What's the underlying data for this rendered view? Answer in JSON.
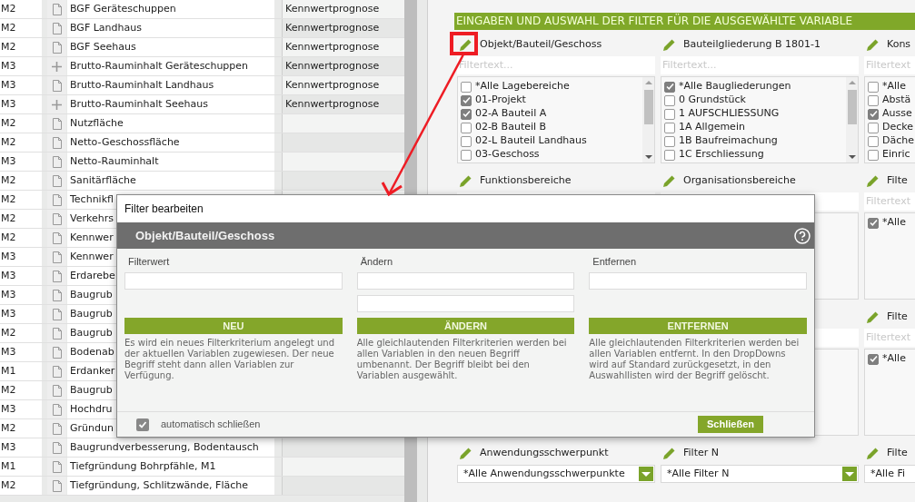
{
  "variables_table": {
    "rows": [
      {
        "unit": "M2",
        "kind": "leaf",
        "name": "BGF Geräteschuppen",
        "type": "Kennwertprognose"
      },
      {
        "unit": "M2",
        "kind": "leaf",
        "name": "BGF Landhaus",
        "type": "Kennwertprognose"
      },
      {
        "unit": "M2",
        "kind": "leaf",
        "name": "BGF Seehaus",
        "type": "Kennwertprognose"
      },
      {
        "unit": "M3",
        "kind": "group",
        "name": "Brutto-Rauminhalt Geräteschuppen",
        "type": "Kennwertprognose"
      },
      {
        "unit": "M3",
        "kind": "leaf",
        "name": "Brutto-Rauminhalt Landhaus",
        "type": "Kennwertprognose"
      },
      {
        "unit": "M3",
        "kind": "group",
        "name": "Brutto-Rauminhalt Seehaus",
        "type": "Kennwertprognose"
      },
      {
        "unit": "M2",
        "kind": "leaf",
        "name": "Nutzfläche"
      },
      {
        "unit": "M2",
        "kind": "leaf",
        "name": "Netto-Geschossfläche"
      },
      {
        "unit": "M3",
        "kind": "leaf",
        "name": "Netto-Rauminhalt"
      },
      {
        "unit": "M2",
        "kind": "leaf",
        "name": "Sanitärfläche"
      },
      {
        "unit": "M2",
        "kind": "leaf",
        "name": "Technikfl"
      },
      {
        "unit": "M2",
        "kind": "leaf",
        "name": "Verkehrs"
      },
      {
        "unit": "M2",
        "kind": "leaf",
        "name": "Kennwer"
      },
      {
        "unit": "M3",
        "kind": "leaf",
        "name": "Kennwer"
      },
      {
        "unit": "M3",
        "kind": "leaf",
        "name": "Erdarebe"
      },
      {
        "unit": "M3",
        "kind": "leaf",
        "name": "Baugrub"
      },
      {
        "unit": "M3",
        "kind": "leaf",
        "name": "Baugrub"
      },
      {
        "unit": "M2",
        "kind": "leaf",
        "name": "Baugrub"
      },
      {
        "unit": "M3",
        "kind": "leaf",
        "name": "Bodenab"
      },
      {
        "unit": "M1",
        "kind": "leaf",
        "name": "Erdanker"
      },
      {
        "unit": "M2",
        "kind": "leaf",
        "name": "Baugrub"
      },
      {
        "unit": "M3",
        "kind": "leaf",
        "name": "Hochdru"
      },
      {
        "unit": "M2",
        "kind": "leaf",
        "name": "Gründun"
      },
      {
        "unit": "M3",
        "kind": "leaf",
        "name": "Baugrundverbesserung, Bodentausch"
      },
      {
        "unit": "M1",
        "kind": "leaf",
        "name": "Tiefgründung Bohrpfähle, M1"
      },
      {
        "unit": "M2",
        "kind": "leaf",
        "name": "Tiefgründung, Schlitzwände, Fläche"
      }
    ]
  },
  "filter_panel": {
    "title": "EINGABEN UND AUSWAHL DER FILTER FÜR DIE AUSGEWÄHLTE VARIABLE",
    "columns": [
      {
        "groups": [
          {
            "kind": "list",
            "title": "Objekt/Bauteil/Geschoss",
            "placeholder": "Filtertext...",
            "items": [
              {
                "label": "*Alle Lagebereiche",
                "checked": false
              },
              {
                "label": "01-Projekt",
                "checked": true
              },
              {
                "label": "02-A Bauteil A",
                "checked": true
              },
              {
                "label": "02-B Bauteil B",
                "checked": false
              },
              {
                "label": "02-L Bauteil Landhaus",
                "checked": false
              },
              {
                "label": "03-Geschoss",
                "checked": false
              }
            ]
          },
          {
            "kind": "blank",
            "title": "Funktionsbereiche"
          },
          {
            "kind": "blank"
          },
          {
            "kind": "dropdown",
            "title": "Anwendungsschwerpunkt",
            "value": "*Alle Anwendungsschwerpunkte"
          }
        ]
      },
      {
        "groups": [
          {
            "kind": "list",
            "title": "Bauteilgliederung B 1801-1",
            "placeholder": "Filtertext...",
            "items": [
              {
                "label": "*Alle Baugliederungen",
                "checked": true
              },
              {
                "label": "0 Grundstück",
                "checked": false
              },
              {
                "label": "1 AUFSCHLIESSUNG",
                "checked": false
              },
              {
                "label": "1A Allgemein",
                "checked": false
              },
              {
                "label": "1B Baufreimachung",
                "checked": false
              },
              {
                "label": "1C Erschliessung",
                "checked": false
              }
            ]
          },
          {
            "kind": "blank",
            "title": "Organisationsbereiche"
          },
          {
            "kind": "blank"
          },
          {
            "kind": "dropdown",
            "title": "Filter N",
            "value": "*Alle Filter N"
          }
        ]
      },
      {
        "groups": [
          {
            "kind": "list",
            "title": "Kons",
            "placeholder": "Filtertext",
            "items": [
              {
                "label": "*Alle",
                "checked": false
              },
              {
                "label": "Abstä",
                "checked": false
              },
              {
                "label": "Ausse",
                "checked": true
              },
              {
                "label": "Decke",
                "checked": false
              },
              {
                "label": "Däche",
                "checked": false
              },
              {
                "label": "Einric",
                "checked": false
              }
            ]
          },
          {
            "kind": "list",
            "title": "Filte",
            "placeholder": "Filtertext",
            "items": [
              {
                "label": "*Alle",
                "checked": true
              }
            ]
          },
          {
            "kind": "list",
            "title": "Filte",
            "placeholder": "Filtertext",
            "items": [
              {
                "label": "*Alle",
                "checked": true
              }
            ]
          },
          {
            "kind": "dropdown",
            "title": "Filte",
            "value": "*Alle Fi"
          }
        ]
      }
    ]
  },
  "dialog": {
    "title": "Filter bearbeiten",
    "header": "Objekt/Bauteil/Geschoss",
    "sections": [
      {
        "label": "Filterwert",
        "inputs": [
          {
            "kind": "text"
          }
        ],
        "button": "NEU",
        "description": "Es wird ein neues Filterkriterium angelegt und der aktuellen Variablen zugewiesen. Der neue Begriff steht dann allen Variablen zur Verfügung."
      },
      {
        "label": "Ändern",
        "inputs": [
          {
            "kind": "text"
          },
          {
            "kind": "text"
          }
        ],
        "button": "ÄNDERN",
        "description": "Alle gleichlautenden Filterkriterien werden bei allen Variablen in den neuen Begriff umbenannt. Der Begriff bleibt bei den Variablen ausgewählt."
      },
      {
        "label": "Entfernen",
        "inputs": [
          {
            "kind": "text"
          }
        ],
        "button": "ENTFERNEN",
        "description": "Alle gleichlautenden Filterkriterien werden bei allen Variablen entfernt. In den DropDowns wird auf Standard zurückgesetzt, in den Auswahllisten wird der Begriff gelöscht."
      }
    ],
    "auto_close": {
      "label": "automatisch schließen",
      "checked": true
    },
    "close_button": "Schließen"
  }
}
